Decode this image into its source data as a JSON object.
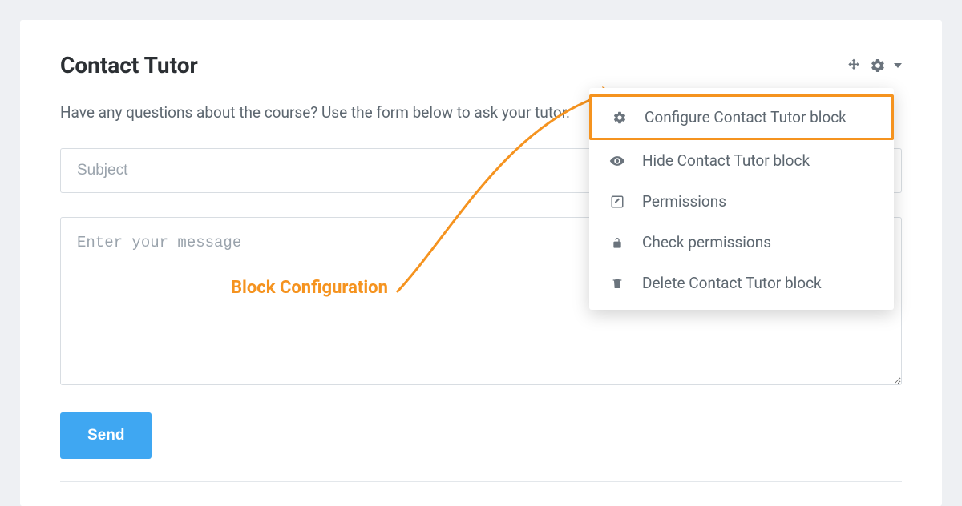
{
  "block": {
    "title": "Contact Tutor",
    "intro": "Have any questions about the course? Use the form below to ask your tutor.",
    "subject_placeholder": "Subject",
    "message_placeholder": "Enter your message",
    "send_label": "Send"
  },
  "menu": {
    "configure": "Configure Contact Tutor block",
    "hide": "Hide Contact Tutor block",
    "permissions": "Permissions",
    "check_permissions": "Check permissions",
    "delete": "Delete Contact Tutor block"
  },
  "annotation": {
    "label": "Block Configuration"
  }
}
